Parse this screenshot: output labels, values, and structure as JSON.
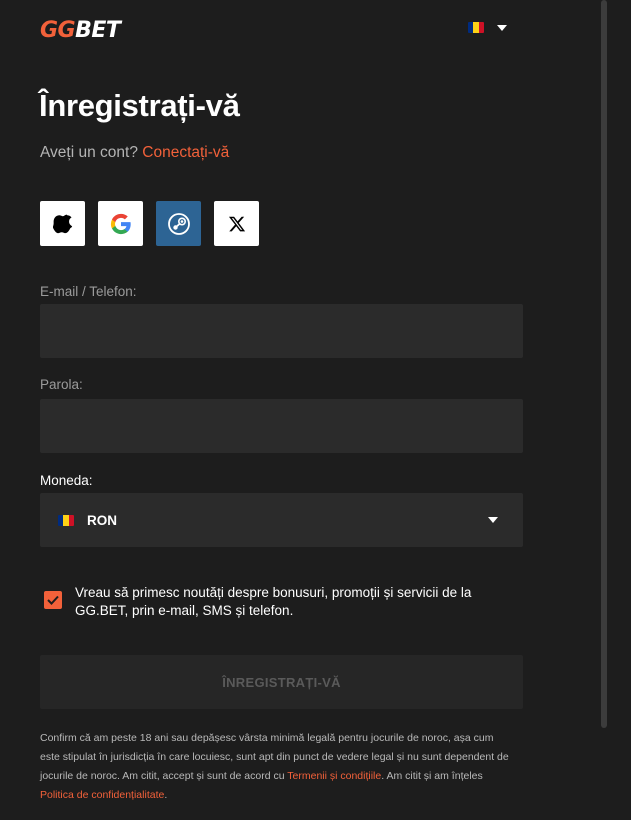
{
  "brand": {
    "part1": "GG",
    "part2": "BET"
  },
  "language": {
    "flag_icon": "romania-flag-icon",
    "flag_colors": [
      "#002B7F",
      "#FCD116",
      "#CE1126"
    ]
  },
  "heading": "Înregistrați-vă",
  "login_prompt": {
    "text": "Aveți un cont?",
    "link": "Conectați-vă"
  },
  "social_buttons": [
    {
      "name": "apple-icon"
    },
    {
      "name": "google-icon"
    },
    {
      "name": "steam-icon"
    },
    {
      "name": "x-icon"
    }
  ],
  "fields": {
    "email": {
      "label": "E-mail / Telefon:",
      "value": ""
    },
    "password": {
      "label": "Parola:",
      "value": ""
    },
    "currency": {
      "label": "Moneda:",
      "value": "RON"
    }
  },
  "newsletter": {
    "checked": true,
    "text": "Vreau să primesc noutăți despre bonusuri, promoții și servicii de la GG.BET, prin e-mail, SMS și telefon."
  },
  "submit_label": "ÎNREGISTRAȚI-VĂ",
  "legal": {
    "text_before": "Confirm că am peste 18 ani sau depășesc vârsta minimă legală pentru jocurile de noroc, așa cum este stipulat în jurisdicția în care locuiesc, sunt apt din punct de vedere legal și nu sunt dependent de jocurile de noroc. Am citit, accept și sunt de acord cu ",
    "terms_link": "Termenii și condițiile",
    "text_middle": ". Am citit și am înțeles ",
    "privacy_link": "Politica de confidențialitate",
    "text_after": "."
  },
  "colors": {
    "accent": "#f2613a",
    "background": "#1d1d1d",
    "field": "#2b2b2b",
    "steam": "#2d6494"
  }
}
